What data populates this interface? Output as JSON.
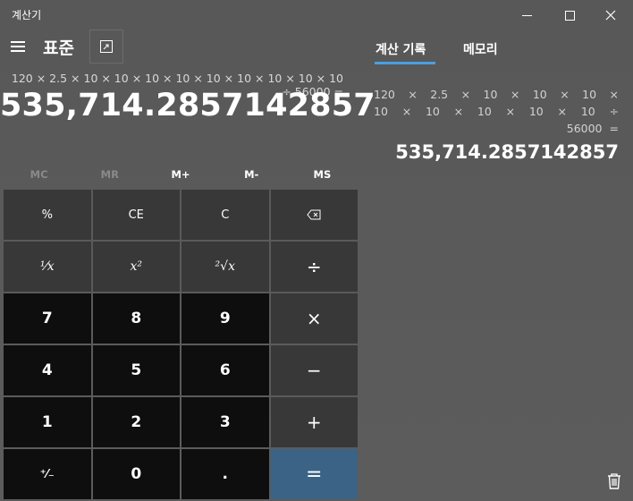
{
  "window": {
    "title": "계산기"
  },
  "header": {
    "mode_title": "표준"
  },
  "display": {
    "expression": "120 × 2.5 × 10 × 10 × 10 × 10 × 10 × 10 × 10 × 10 × 10 ÷ 56000 =",
    "value": "535,714.2857142857"
  },
  "memory": {
    "mc": "MC",
    "mr": "MR",
    "mplus": "M+",
    "mminus": "M-",
    "ms": "MS"
  },
  "keys": {
    "percent": "%",
    "ce": "CE",
    "c": "C",
    "reciprocal": "¹⁄x",
    "square": "x²",
    "sqrt": "²√x",
    "divide": "÷",
    "k7": "7",
    "k8": "8",
    "k9": "9",
    "multiply": "×",
    "k4": "4",
    "k5": "5",
    "k6": "6",
    "minus": "−",
    "k1": "1",
    "k2": "2",
    "k3": "3",
    "plus": "+",
    "negate": "⁺⁄₋",
    "k0": "0",
    "decimal": ".",
    "equals": "="
  },
  "panel": {
    "tab_history": "계산 기록",
    "tab_memory": "메모리",
    "history": {
      "line1": [
        "120",
        "×",
        "2.5",
        "×",
        "10",
        "×",
        "10",
        "×",
        "10",
        "×"
      ],
      "line2": [
        "10",
        "×",
        "10",
        "×",
        "10",
        "×",
        "10",
        "×",
        "10",
        "÷"
      ],
      "line3": [
        "56000",
        "="
      ],
      "result": "535,714.2857142857"
    }
  },
  "colors": {
    "accent": "#4a9fe0",
    "equals": "#3a6386",
    "num_key": "#0e0e0e",
    "fn_key": "#383838"
  }
}
